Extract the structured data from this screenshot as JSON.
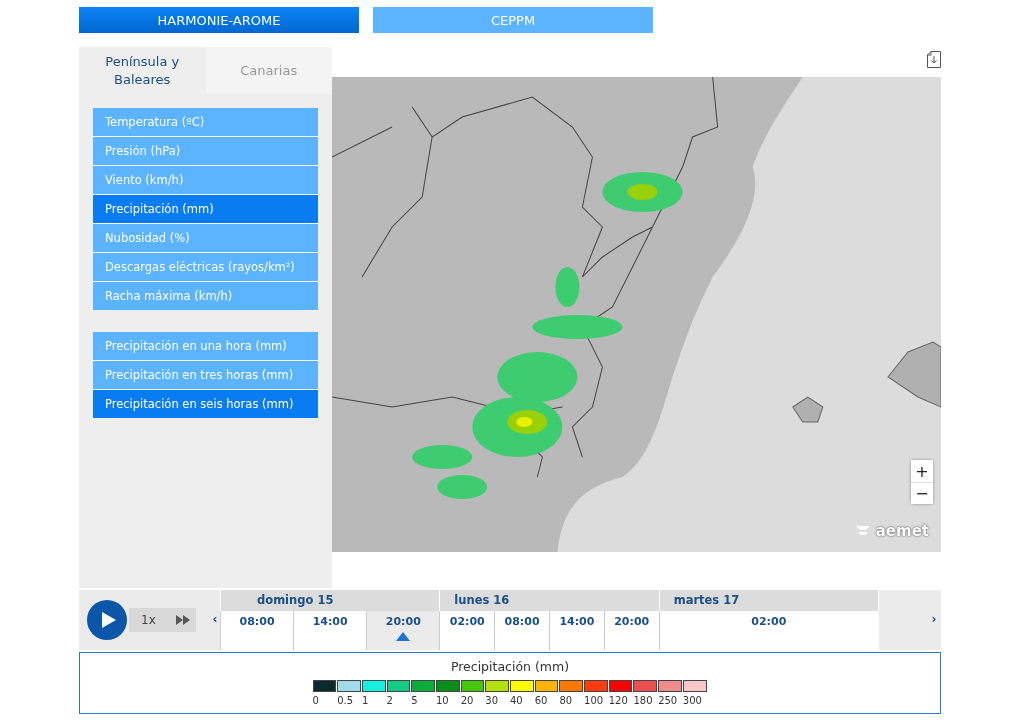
{
  "models": [
    {
      "label": "HARMONIE-AROME",
      "selected": true
    },
    {
      "label": "CEPPM",
      "selected": false
    }
  ],
  "regions": [
    {
      "label": "Península y Baleares",
      "selected": true
    },
    {
      "label": "Canarias",
      "selected": false
    }
  ],
  "variable_groups": [
    [
      {
        "label": "Temperatura (ºC)",
        "selected": false
      },
      {
        "label": "Presión (hPa)",
        "selected": false
      },
      {
        "label": "Viento (km/h)",
        "selected": false
      },
      {
        "label": "Precipitación (mm)",
        "selected": true
      },
      {
        "label": "Nubosidad (%)",
        "selected": false
      },
      {
        "label": "Descargas eléctricas (rayos/km²)",
        "selected": false
      },
      {
        "label": "Racha máxima (km/h)",
        "selected": false
      }
    ],
    [
      {
        "label": "Precipitación en una hora (mm)",
        "selected": false
      },
      {
        "label": "Precipitación en tres horas (mm)",
        "selected": false
      },
      {
        "label": "Precipitación en seis horas (mm)",
        "selected": true
      }
    ]
  ],
  "map": {
    "zoom_in": "+",
    "zoom_out": "−",
    "logo": "aemet"
  },
  "player": {
    "speed": "1x",
    "prev": "‹",
    "next": "›"
  },
  "days": [
    {
      "label": "domingo 15",
      "hours": [
        {
          "label": "08:00",
          "selected": false
        },
        {
          "label": "14:00",
          "selected": false
        },
        {
          "label": "20:00",
          "selected": true
        }
      ]
    },
    {
      "label": "lunes 16",
      "hours": [
        {
          "label": "02:00",
          "selected": false
        },
        {
          "label": "08:00",
          "selected": false
        },
        {
          "label": "14:00",
          "selected": false
        },
        {
          "label": "20:00",
          "selected": false
        }
      ]
    },
    {
      "label": "martes 17",
      "hours": [
        {
          "label": "02:00",
          "selected": false
        }
      ]
    }
  ],
  "legend": {
    "title": "Precipitación (mm)",
    "items": [
      {
        "label": "0",
        "color": "#0a2a2e"
      },
      {
        "label": "0.5",
        "color": "#9fdbe8"
      },
      {
        "label": "1",
        "color": "#16f0e0"
      },
      {
        "label": "2",
        "color": "#12cc84"
      },
      {
        "label": "5",
        "color": "#0aad3a"
      },
      {
        "label": "10",
        "color": "#058f18"
      },
      {
        "label": "20",
        "color": "#45c80a"
      },
      {
        "label": "30",
        "color": "#b3e20a"
      },
      {
        "label": "40",
        "color": "#ffff00"
      },
      {
        "label": "60",
        "color": "#ffb400"
      },
      {
        "label": "80",
        "color": "#ff7800"
      },
      {
        "label": "100",
        "color": "#ff3c0a"
      },
      {
        "label": "120",
        "color": "#ff0000"
      },
      {
        "label": "180",
        "color": "#ea5050"
      },
      {
        "label": "250",
        "color": "#f08c8c"
      },
      {
        "label": "300",
        "color": "#f8c8c8"
      }
    ]
  }
}
